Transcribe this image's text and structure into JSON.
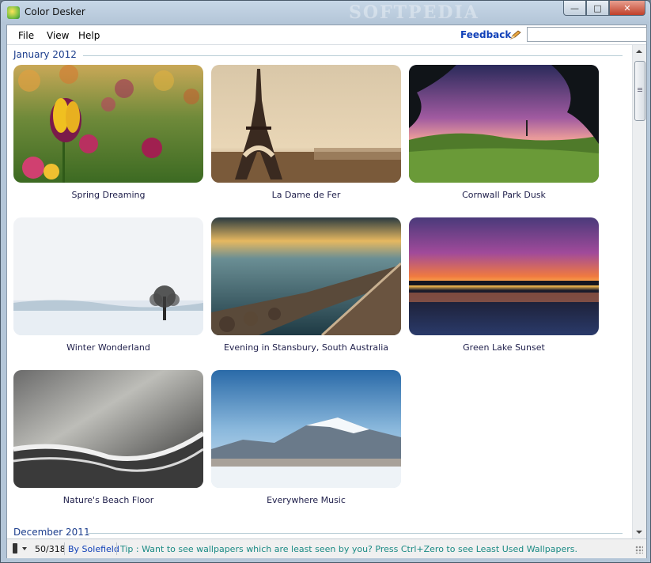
{
  "window": {
    "title": "Color Desker",
    "watermark": "SOFTPEDIA"
  },
  "menu": {
    "file": "File",
    "view": "View",
    "help": "Help",
    "feedback": "Feedback"
  },
  "search": {
    "value": "",
    "placeholder": ""
  },
  "sections": [
    {
      "label": "January 2012",
      "items": [
        {
          "caption": "Spring Dreaming",
          "icon": "wallpaper-tulips"
        },
        {
          "caption": "La Dame de Fer",
          "icon": "wallpaper-eiffel-tower"
        },
        {
          "caption": "Cornwall Park Dusk",
          "icon": "wallpaper-park-dusk"
        },
        {
          "caption": "Winter Wonderland",
          "icon": "wallpaper-winter-tree"
        },
        {
          "caption": "Evening in Stansbury, South Australia",
          "icon": "wallpaper-jetty"
        },
        {
          "caption": "Green Lake Sunset",
          "icon": "wallpaper-lake-sunset"
        },
        {
          "caption": "Nature's Beach Floor",
          "icon": "wallpaper-beach"
        },
        {
          "caption": "Everywhere Music",
          "icon": "wallpaper-snow-mountain"
        }
      ]
    },
    {
      "label": "December 2011",
      "items": []
    }
  ],
  "status": {
    "count": "50/318",
    "author": "By Solefield",
    "tip": "Tip : Want to see wallpapers which are least seen by you? Press Ctrl+Zero to see Least Used Wallpapers."
  },
  "colors": {
    "accent": "#1040b8",
    "section_header": "#1a3c8c",
    "tip_text": "#1a8a84"
  }
}
